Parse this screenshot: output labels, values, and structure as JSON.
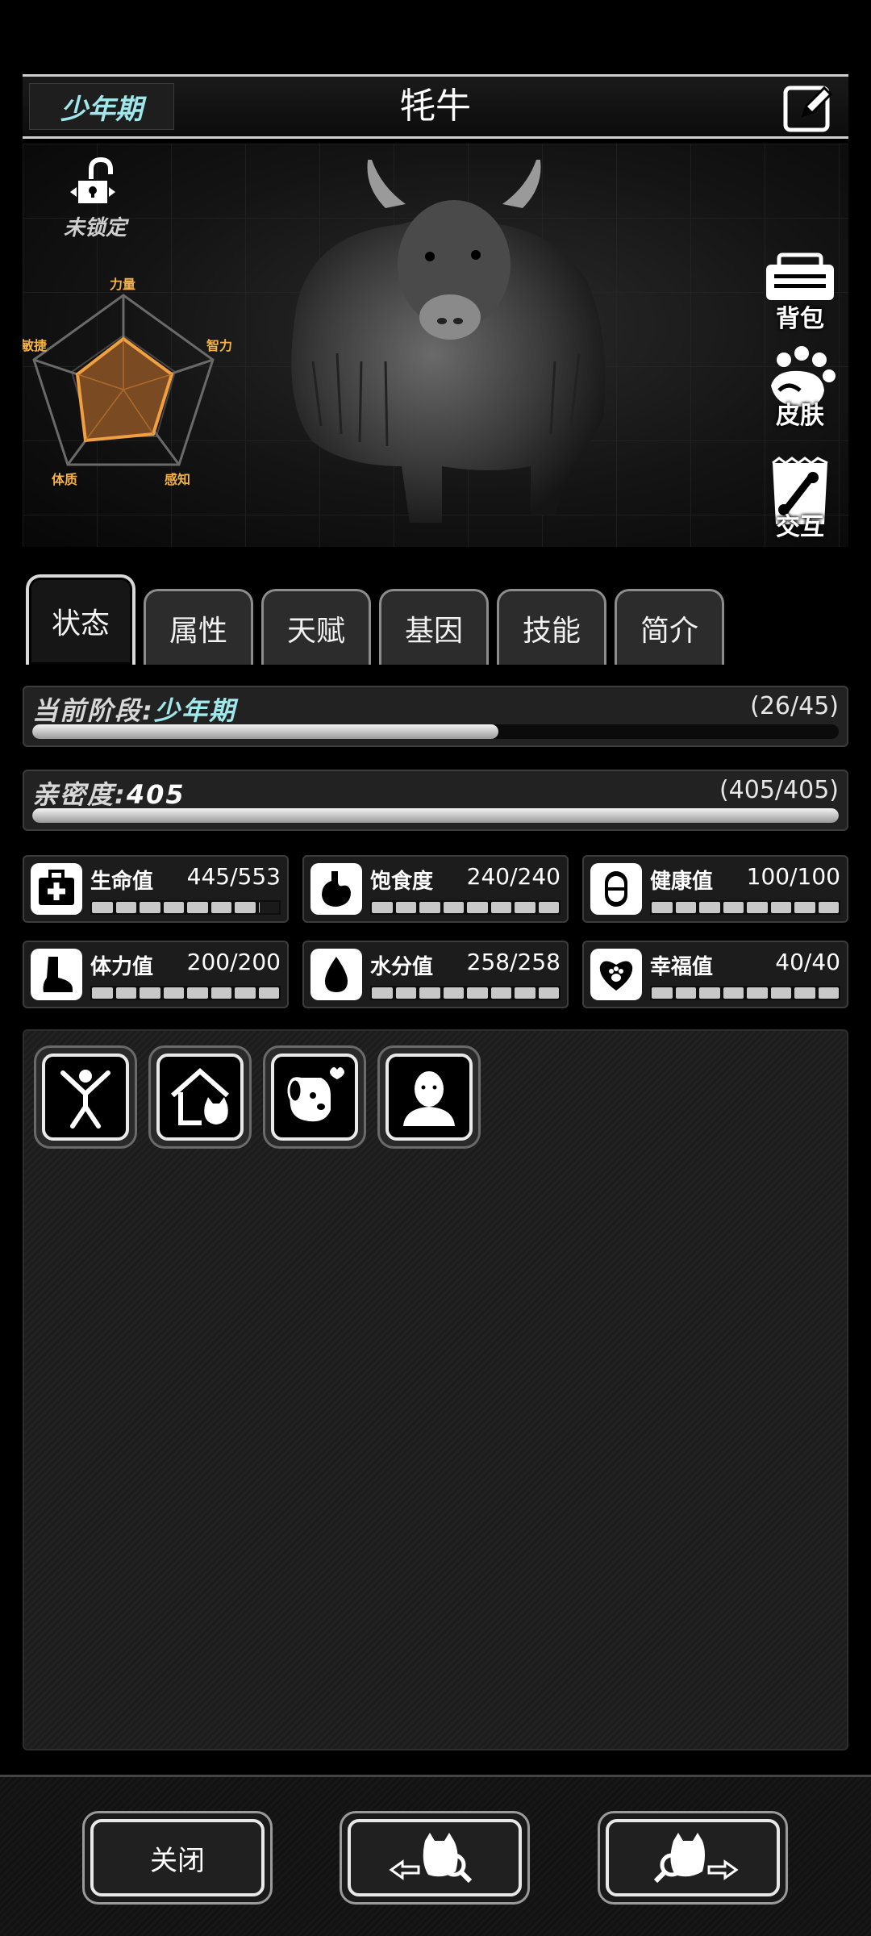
{
  "header": {
    "stage": "少年期",
    "title": "牦牛"
  },
  "lock": {
    "label": "未锁定"
  },
  "radar": {
    "labels": {
      "strength": "力量",
      "intelligence": "智力",
      "perception": "感知",
      "constitution": "体质",
      "agility": "敏捷"
    }
  },
  "side_buttons": {
    "bag": "背包",
    "skin": "皮肤",
    "interact": "交互"
  },
  "tabs": [
    "状态",
    "属性",
    "天赋",
    "基因",
    "技能",
    "简介"
  ],
  "stage_bar": {
    "label": "当前阶段:",
    "value": "少年期",
    "count": "(26/45)",
    "progress": 0.578
  },
  "intimacy_bar": {
    "label": "亲密度:",
    "value": "405",
    "count": "(405/405)",
    "progress": 1.0
  },
  "stats": [
    {
      "name": "生命值",
      "value": "445/553",
      "icon": "first-aid-icon",
      "filled": 7.04
    },
    {
      "name": "饱食度",
      "value": "240/240",
      "icon": "stomach-icon",
      "filled": 8
    },
    {
      "name": "健康值",
      "value": "100/100",
      "icon": "pill-icon",
      "filled": 8
    },
    {
      "name": "体力值",
      "value": "200/200",
      "icon": "foot-icon",
      "filled": 8
    },
    {
      "name": "水分值",
      "value": "258/258",
      "icon": "water-drop-icon",
      "filled": 8
    },
    {
      "name": "幸福值",
      "value": "40/40",
      "icon": "heart-paw-icon",
      "filled": 8
    }
  ],
  "actions": [
    "stretch-icon",
    "home-cat-icon",
    "dog-affection-icon",
    "person-icon"
  ],
  "footer": {
    "close": "关闭"
  }
}
